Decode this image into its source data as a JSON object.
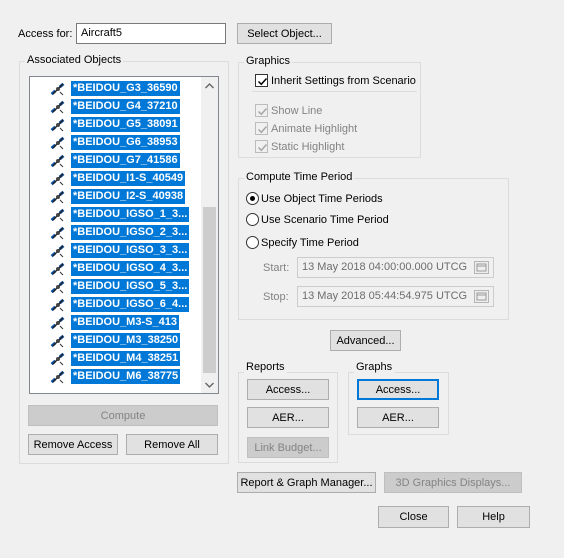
{
  "access_for": {
    "label": "Access for:",
    "value": "Aircraft5"
  },
  "select_object_label": "Select Object...",
  "associated_objects": {
    "title": "Associated Objects",
    "items": [
      "*BEIDOU_G3_36590",
      "*BEIDOU_G4_37210",
      "*BEIDOU_G5_38091",
      "*BEIDOU_G6_38953",
      "*BEIDOU_G7_41586",
      "*BEIDOU_I1-S_40549",
      "*BEIDOU_I2-S_40938",
      "*BEIDOU_IGSO_1_3...",
      "*BEIDOU_IGSO_2_3...",
      "*BEIDOU_IGSO_3_3...",
      "*BEIDOU_IGSO_4_3...",
      "*BEIDOU_IGSO_5_3...",
      "*BEIDOU_IGSO_6_4...",
      "*BEIDOU_M3-S_413",
      "*BEIDOU_M3_38250",
      "*BEIDOU_M4_38251",
      "*BEIDOU_M6_38775"
    ],
    "compute_label": "Compute",
    "remove_access_label": "Remove Access",
    "remove_all_label": "Remove All"
  },
  "graphics": {
    "title": "Graphics",
    "inherit_label": "Inherit Settings from Scenario",
    "inherit_checked": true,
    "show_line_label": "Show Line",
    "animate_highlight_label": "Animate Highlight",
    "static_highlight_label": "Static Highlight"
  },
  "compute_time_period": {
    "title": "Compute Time Period",
    "use_object_label": "Use Object Time Periods",
    "use_scenario_label": "Use Scenario Time Period",
    "specify_label": "Specify Time Period",
    "selected": "use_object",
    "start_label": "Start:",
    "start_value": "13 May 2018 04:00:00.000 UTCG",
    "stop_label": "Stop:",
    "stop_value": "13 May 2018 05:44:54.975 UTCG"
  },
  "advanced_label": "Advanced...",
  "reports": {
    "title": "Reports",
    "access_label": "Access...",
    "aer_label": "AER...",
    "link_budget_label": "Link Budget..."
  },
  "graphs": {
    "title": "Graphs",
    "access_label": "Access...",
    "aer_label": "AER..."
  },
  "report_graph_manager_label": "Report & Graph Manager...",
  "graphics_displays_label": "3D Graphics Displays...",
  "close_label": "Close",
  "help_label": "Help"
}
